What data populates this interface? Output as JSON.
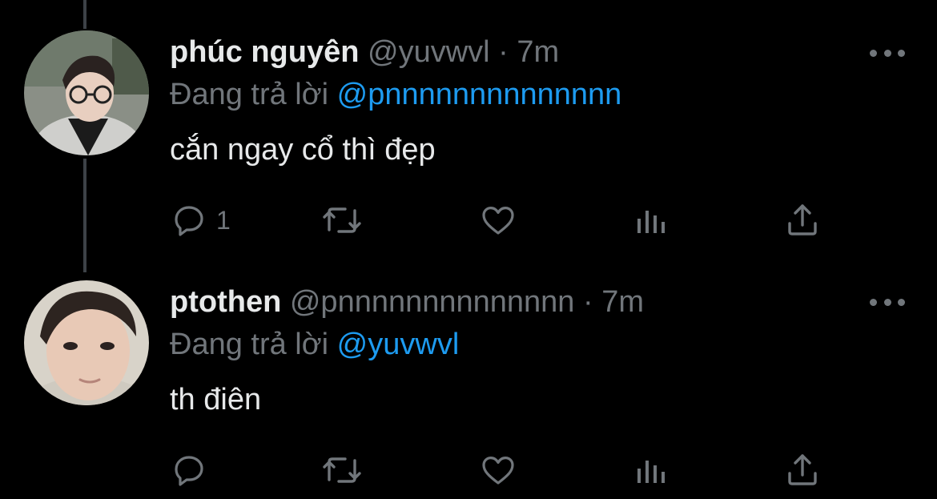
{
  "accent_color": "#1d9bf0",
  "muted_color": "#71767b",
  "text_color": "#e7e9ea",
  "tweets": [
    {
      "display_name": "phúc nguyên",
      "handle": "@yuvwvl",
      "separator": "·",
      "time": "7m",
      "reply_prefix": "Đang trả lời",
      "reply_to": "@pnnnnnnnnnnnnnn",
      "text": "cắn ngay cổ thì đẹp",
      "reply_count": "1",
      "icons": [
        "reply-icon",
        "retweet-icon",
        "like-icon",
        "views-icon",
        "share-icon",
        "more-icon"
      ]
    },
    {
      "display_name": "ptothen",
      "handle": "@pnnnnnnnnnnnnnn",
      "separator": "·",
      "time": "7m",
      "reply_prefix": "Đang trả lời",
      "reply_to": "@yuvwvl",
      "text": "th điên",
      "reply_count": "",
      "icons": [
        "reply-icon",
        "retweet-icon",
        "like-icon",
        "views-icon",
        "share-icon",
        "more-icon"
      ]
    }
  ]
}
